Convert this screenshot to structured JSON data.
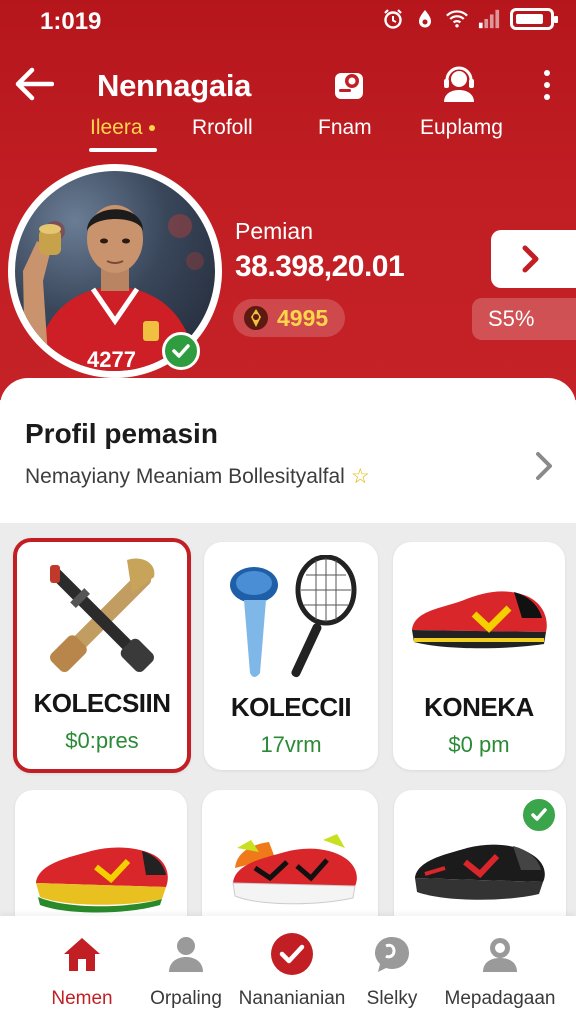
{
  "status_bar": {
    "time": "1:019",
    "icons": [
      "alarm-icon",
      "data-saver-icon",
      "wifi-icon",
      "signal-icon",
      "battery-icon"
    ],
    "battery_level": 0.85
  },
  "header": {
    "title": "Nennagaia",
    "actions": [
      "profile-card-icon",
      "support-agent-icon",
      "more-icon"
    ],
    "tabs": [
      {
        "label": "Ileera",
        "active": true
      },
      {
        "label": "Rrofoll",
        "active": false
      },
      {
        "label": "Fnam",
        "active": false
      },
      {
        "label": "Euplamg",
        "active": false
      }
    ]
  },
  "player": {
    "jersey_number": "4277",
    "label": "Pemian",
    "value": "38.398,20.01",
    "coins": "4995",
    "percent": "S5%",
    "verified": true
  },
  "profile_card": {
    "title": "Profil pemasin",
    "subtitle": "Nemayiany Meaniam Bollesityalfal"
  },
  "products": [
    {
      "name": "KOLECSIIN",
      "price": "$0:pres",
      "image": "crossed-bats-icon",
      "selected": true,
      "checked": false
    },
    {
      "name": "KOLECCII",
      "price": "17vrm",
      "image": "racket-and-cup-icon",
      "selected": false,
      "checked": false
    },
    {
      "name": "KONEKA",
      "price": "$0 pm",
      "image": "red-shoe-icon",
      "selected": false,
      "checked": false
    },
    {
      "name": "",
      "price": "",
      "image": "red-green-shoe-icon",
      "selected": false,
      "checked": false
    },
    {
      "name": "",
      "price": "",
      "image": "red-spike-shoe-icon",
      "selected": false,
      "checked": false
    },
    {
      "name": "",
      "price": "",
      "image": "black-shoe-icon",
      "selected": false,
      "checked": true
    }
  ],
  "bottom_nav": [
    {
      "label": "Nemen",
      "icon": "home-icon",
      "active": true
    },
    {
      "label": "Orpaling",
      "icon": "person-icon",
      "active": false
    },
    {
      "label": "Nananianian",
      "icon": "check-circle-icon",
      "active": false
    },
    {
      "label": "Slelky",
      "icon": "chat-bubble-icon",
      "active": false
    },
    {
      "label": "Mepadagaan",
      "icon": "account-icon",
      "active": false
    }
  ],
  "colors": {
    "brand_red": "#c21f24",
    "accent_yellow": "#ffd54a",
    "price_green": "#2b8a36",
    "success_green": "#2e9c3f"
  }
}
